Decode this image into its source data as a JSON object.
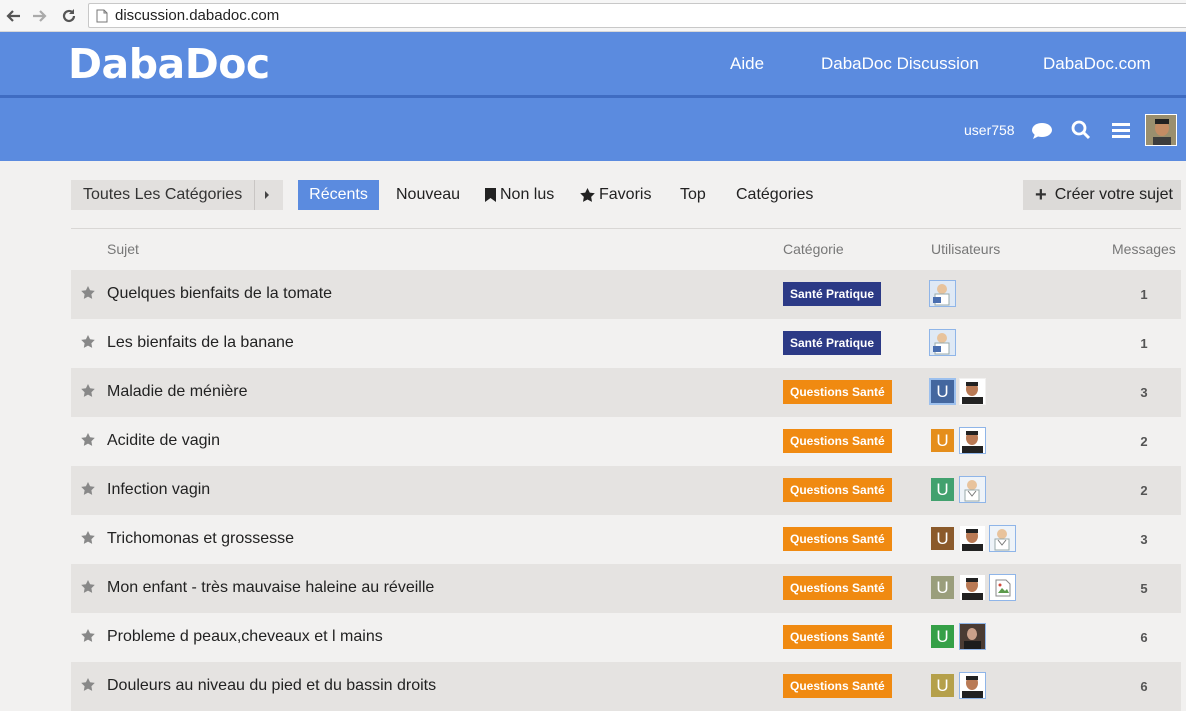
{
  "browser": {
    "url": "discussion.dabadoc.com"
  },
  "header": {
    "logo": "DabaDoc",
    "links": [
      "Aide",
      "DabaDoc Discussion",
      "DabaDoc.com"
    ],
    "username": "user758"
  },
  "controls": {
    "category_dropdown": "Toutes Les Catégories",
    "tabs": [
      "Récents",
      "Nouveau",
      "Non lus",
      "Favoris",
      "Top",
      "Catégories"
    ],
    "create_button": "Créer votre sujet"
  },
  "table": {
    "headers": [
      "Sujet",
      "Catégorie",
      "Utilisateurs",
      "Messages"
    ],
    "rows": [
      {
        "title": "Quelques bienfaits de la tomate",
        "category": "Santé Pratique",
        "messages": "1"
      },
      {
        "title": "Les bienfaits de la banane",
        "category": "Santé Pratique",
        "messages": "1"
      },
      {
        "title": "Maladie de ménière",
        "category": "Questions Santé",
        "messages": "3"
      },
      {
        "title": "Acidite de vagin",
        "category": "Questions Santé",
        "messages": "2"
      },
      {
        "title": "Infection vagin",
        "category": "Questions Santé",
        "messages": "2"
      },
      {
        "title": "Trichomonas et grossesse",
        "category": "Questions Santé",
        "messages": "3"
      },
      {
        "title": "Mon enfant - très mauvaise haleine au réveille",
        "category": "Questions Santé",
        "messages": "5"
      },
      {
        "title": "Probleme d peaux,cheveaux et l mains",
        "category": "Questions Santé",
        "messages": "6"
      },
      {
        "title": "Douleurs au niveau du pied et du bassin droits",
        "category": "Questions Santé",
        "messages": "6"
      }
    ],
    "avatar_letter": "U"
  },
  "colors": {
    "header_blue": "#5b8bdf",
    "active_tab": "#5b8bdf",
    "sante_pratique": "#2c3a86",
    "questions_sante": "#f08a11"
  }
}
